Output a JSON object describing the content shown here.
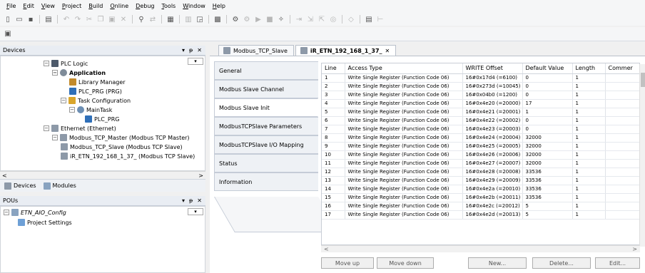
{
  "menu": [
    "File",
    "Edit",
    "View",
    "Project",
    "Build",
    "Online",
    "Debug",
    "Tools",
    "Window",
    "Help"
  ],
  "devices": {
    "title": "Devices",
    "tree": [
      {
        "label": "PLC Logic"
      },
      {
        "label": "Application"
      },
      {
        "label": "Library Manager"
      },
      {
        "label": "PLC_PRG (PRG)"
      },
      {
        "label": "Task Configuration"
      },
      {
        "label": "MainTask"
      },
      {
        "label": "PLC_PRG"
      },
      {
        "label": "Ethernet (Ethernet)"
      },
      {
        "label": "Modbus_TCP_Master (Modbus TCP Master)"
      },
      {
        "label": "Modbus_TCP_Slave (Modbus TCP Slave)"
      },
      {
        "label": "iR_ETN_192_168_1_37_ (Modbus TCP Slave)"
      }
    ],
    "bottom_tabs": [
      "Devices",
      "Modules"
    ]
  },
  "pous": {
    "title": "POUs",
    "tree": [
      {
        "label": "ETN_AIO_Config"
      },
      {
        "label": "Project Settings"
      }
    ]
  },
  "editor": {
    "doc_tabs": [
      "Modbus_TCP_Slave",
      "iR_ETN_192_168_1_37_"
    ],
    "side_tabs": [
      "General",
      "Modbus Slave Channel",
      "Modbus Slave Init",
      "ModbusTCPSlave Parameters",
      "ModbusTCPSlave I/O Mapping",
      "Status",
      "Information"
    ],
    "table": {
      "headers": [
        "Line",
        "Access Type",
        "WRITE Offset",
        "Default Value",
        "Length",
        "Commer"
      ],
      "rows": [
        [
          "1",
          "Write Single Register (Function Code 06)",
          "16#0x17d4 (=6100)",
          "0",
          "1"
        ],
        [
          "2",
          "Write Single Register (Function Code 06)",
          "16#0x273d (=10045)",
          "0",
          "1"
        ],
        [
          "3",
          "Write Single Register (Function Code 06)",
          "16#0x04b0 (=1200)",
          "0",
          "1"
        ],
        [
          "4",
          "Write Single Register (Function Code 06)",
          "16#0x4e20 (=20000)",
          "17",
          "1"
        ],
        [
          "5",
          "Write Single Register (Function Code 06)",
          "16#0x4e21 (=20001)",
          "1",
          "1"
        ],
        [
          "6",
          "Write Single Register (Function Code 06)",
          "16#0x4e22 (=20002)",
          "0",
          "1"
        ],
        [
          "7",
          "Write Single Register (Function Code 06)",
          "16#0x4e23 (=20003)",
          "0",
          "1"
        ],
        [
          "8",
          "Write Single Register (Function Code 06)",
          "16#0x4e24 (=20004)",
          "32000",
          "1"
        ],
        [
          "9",
          "Write Single Register (Function Code 06)",
          "16#0x4e25 (=20005)",
          "32000",
          "1"
        ],
        [
          "10",
          "Write Single Register (Function Code 06)",
          "16#0x4e26 (=20006)",
          "32000",
          "1"
        ],
        [
          "11",
          "Write Single Register (Function Code 06)",
          "16#0x4e27 (=20007)",
          "32000",
          "1"
        ],
        [
          "12",
          "Write Single Register (Function Code 06)",
          "16#0x4e28 (=20008)",
          "33536",
          "1"
        ],
        [
          "13",
          "Write Single Register (Function Code 06)",
          "16#0x4e29 (=20009)",
          "33536",
          "1"
        ],
        [
          "14",
          "Write Single Register (Function Code 06)",
          "16#0x4e2a (=20010)",
          "33536",
          "1"
        ],
        [
          "15",
          "Write Single Register (Function Code 06)",
          "16#0x4e2b (=20011)",
          "33536",
          "1"
        ],
        [
          "16",
          "Write Single Register (Function Code 06)",
          "16#0x4e2c (=20012)",
          "5",
          "1"
        ],
        [
          "17",
          "Write Single Register (Function Code 06)",
          "16#0x4e2d (=20013)",
          "5",
          "1"
        ]
      ]
    },
    "buttons": [
      "Move up",
      "Move down",
      "New...",
      "Delete...",
      "Edit..."
    ]
  },
  "glyphs": {
    "close": "✕",
    "pin": "ᵽ",
    "dropdown": "▾",
    "left": "<",
    "right": ">",
    "plus": "+",
    "minus": "−"
  },
  "colors": {
    "panel_header": "#e9edf3",
    "active_tab": "#ffffff",
    "border": "#c5ccd7"
  }
}
